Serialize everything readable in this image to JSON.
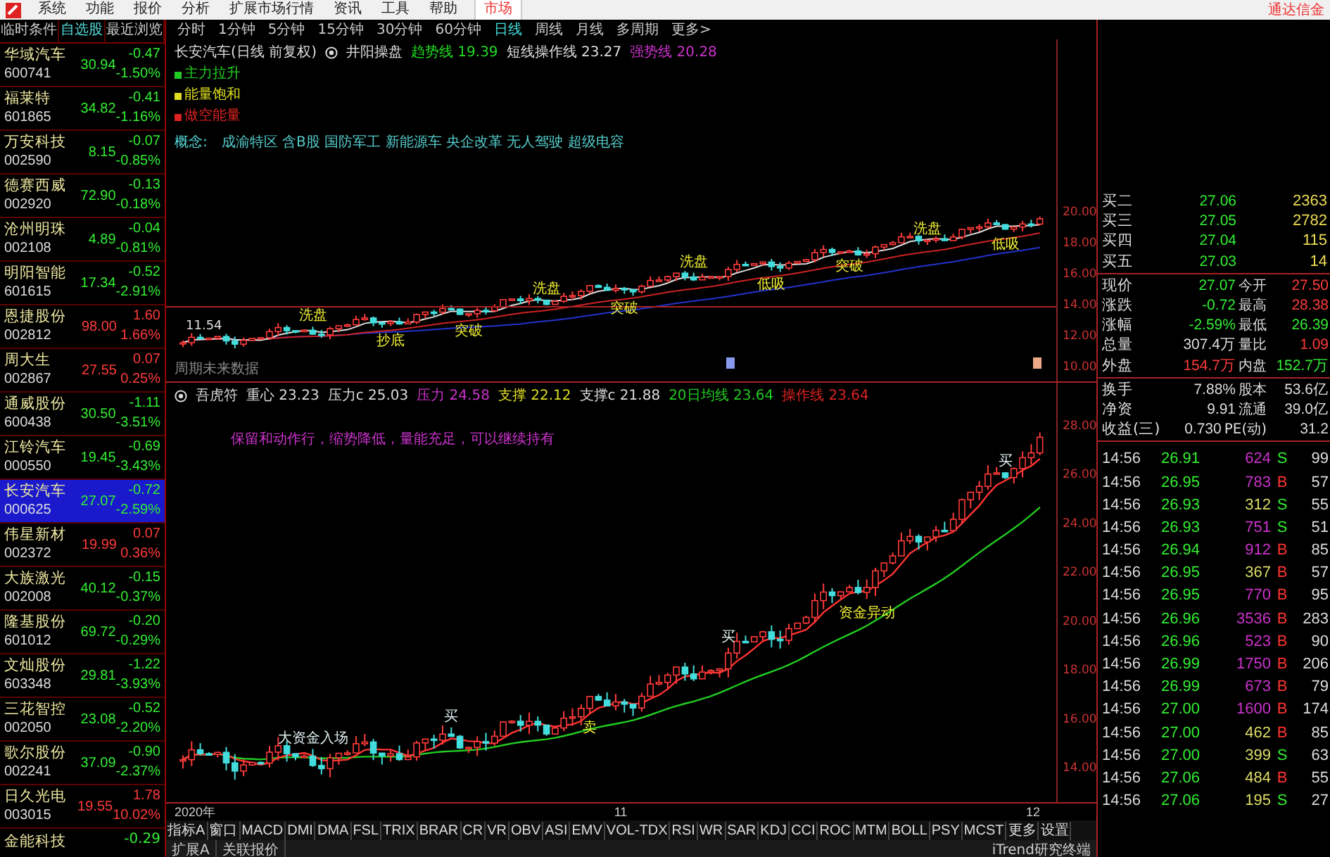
{
  "menu": {
    "items": [
      {
        "label": "系统",
        "selected": false
      },
      {
        "label": "功能",
        "selected": false
      },
      {
        "label": "报价",
        "selected": false
      },
      {
        "label": "分析",
        "selected": false
      },
      {
        "label": "扩展市场行情",
        "selected": false
      },
      {
        "label": "资讯",
        "selected": false
      },
      {
        "label": "工具",
        "selected": false
      },
      {
        "label": "帮助",
        "selected": false
      },
      {
        "label": "市场",
        "selected": true
      }
    ],
    "right_text": "通达信金"
  },
  "watchlist": {
    "tabs": [
      {
        "label": "临时条件",
        "selected": false
      },
      {
        "label": "自选股",
        "selected": true
      },
      {
        "label": "最近浏览",
        "selected": false
      }
    ],
    "rows": [
      {
        "name": "华域汽车",
        "code": "600741",
        "price": "30.94",
        "change": "-0.47",
        "pct": "-1.50%",
        "up": false,
        "selected": false
      },
      {
        "name": "福莱特",
        "code": "601865",
        "price": "34.82",
        "change": "-0.41",
        "pct": "-1.16%",
        "up": false,
        "selected": false
      },
      {
        "name": "万安科技",
        "code": "002590",
        "price": "8.15",
        "change": "-0.07",
        "pct": "-0.85%",
        "up": false,
        "selected": false
      },
      {
        "name": "德赛西威",
        "code": "002920",
        "price": "72.90",
        "change": "-0.13",
        "pct": "-0.18%",
        "up": false,
        "selected": false
      },
      {
        "name": "沧州明珠",
        "code": "002108",
        "price": "4.89",
        "change": "-0.04",
        "pct": "-0.81%",
        "up": false,
        "selected": false
      },
      {
        "name": "明阳智能",
        "code": "601615",
        "price": "17.34",
        "change": "-0.52",
        "pct": "-2.91%",
        "up": false,
        "selected": false
      },
      {
        "name": "恩捷股份",
        "code": "002812",
        "price": "98.00",
        "change": "1.60",
        "pct": "1.66%",
        "up": true,
        "selected": false
      },
      {
        "name": "周大生",
        "code": "002867",
        "price": "27.55",
        "change": "0.07",
        "pct": "0.25%",
        "up": true,
        "selected": false
      },
      {
        "name": "通威股份",
        "code": "600438",
        "price": "30.50",
        "change": "-1.11",
        "pct": "-3.51%",
        "up": false,
        "selected": false
      },
      {
        "name": "江铃汽车",
        "code": "000550",
        "price": "19.45",
        "change": "-0.69",
        "pct": "-3.43%",
        "up": false,
        "selected": false
      },
      {
        "name": "长安汽车",
        "code": "000625",
        "price": "27.07",
        "change": "-0.72",
        "pct": "-2.59%",
        "up": false,
        "selected": true
      },
      {
        "name": "伟星新材",
        "code": "002372",
        "price": "19.99",
        "change": "0.07",
        "pct": "0.36%",
        "up": true,
        "selected": false
      },
      {
        "name": "大族激光",
        "code": "002008",
        "price": "40.12",
        "change": "-0.15",
        "pct": "-0.37%",
        "up": false,
        "selected": false
      },
      {
        "name": "隆基股份",
        "code": "601012",
        "price": "69.72",
        "change": "-0.20",
        "pct": "-0.29%",
        "up": false,
        "selected": false
      },
      {
        "name": "文灿股份",
        "code": "603348",
        "price": "29.81",
        "change": "-1.22",
        "pct": "-3.93%",
        "up": false,
        "selected": false
      },
      {
        "name": "三花智控",
        "code": "002050",
        "price": "23.08",
        "change": "-0.52",
        "pct": "-2.20%",
        "up": false,
        "selected": false
      },
      {
        "name": "歌尔股份",
        "code": "002241",
        "price": "37.09",
        "change": "-0.90",
        "pct": "-2.37%",
        "up": false,
        "selected": false
      },
      {
        "name": "日久光电",
        "code": "003015",
        "price": "19.55",
        "change": "1.78",
        "pct": "10.02%",
        "up": true,
        "selected": false
      }
    ],
    "partial_row": {
      "name": "金能科技",
      "change": "-0.29",
      "up": false
    }
  },
  "periods": [
    {
      "label": "分时",
      "selected": false
    },
    {
      "label": "1分钟",
      "selected": false
    },
    {
      "label": "5分钟",
      "selected": false
    },
    {
      "label": "15分钟",
      "selected": false
    },
    {
      "label": "30分钟",
      "selected": false
    },
    {
      "label": "60分钟",
      "selected": false
    },
    {
      "label": "日线",
      "selected": true
    },
    {
      "label": "周线",
      "selected": false
    },
    {
      "label": "月线",
      "selected": false
    },
    {
      "label": "多周期",
      "selected": false
    },
    {
      "label": "更多>",
      "selected": false
    }
  ],
  "upper_chart": {
    "title": "长安汽车(日线 前复权)",
    "indicator": "井阳操盘",
    "readings": [
      {
        "label": "趋势线",
        "value": "19.39",
        "color": "#22dd22"
      },
      {
        "label": "短线操作线",
        "value": "23.27",
        "color": "#dddddd"
      },
      {
        "label": "强势线",
        "value": "20.28",
        "color": "#cc33cc"
      }
    ],
    "legend": [
      {
        "text": "主力拉升",
        "color": "#22cc22"
      },
      {
        "text": "能量饱和",
        "color": "#dddd22"
      },
      {
        "text": "做空能量",
        "color": "#dd2222"
      }
    ],
    "concept_label": "概念:",
    "concepts": "成渝特区 含B股 国防军工 新能源车 央企改革 无人驾驶 超级电容",
    "start_price": "11.54",
    "footnote": "周期未来数据",
    "y_axis": [
      "20.00",
      "18.00",
      "16.00",
      "14.00",
      "12.00",
      "10.00"
    ],
    "signals": [
      {
        "text": "洗盘",
        "kind": "top"
      },
      {
        "text": "抄底",
        "kind": "bottom"
      },
      {
        "text": "突破",
        "kind": "bottom"
      },
      {
        "text": "洗盘",
        "kind": "top"
      },
      {
        "text": "突破",
        "kind": "bottom"
      },
      {
        "text": "洗盘",
        "kind": "top"
      },
      {
        "text": "低吸",
        "kind": "bottom"
      },
      {
        "text": "突破",
        "kind": "bottom"
      },
      {
        "text": "洗盘",
        "kind": "top"
      },
      {
        "text": "低吸",
        "kind": "bottom"
      }
    ]
  },
  "lower_chart": {
    "indicator": "吾虎符",
    "readings": [
      {
        "label": "重心",
        "value": "23.23",
        "color": "#dddddd"
      },
      {
        "label": "压力c",
        "value": "25.03",
        "color": "#dddddd"
      },
      {
        "label": "压力",
        "value": "24.58",
        "color": "#cc33cc"
      },
      {
        "label": "支撑",
        "value": "22.12",
        "color": "#dddd22"
      },
      {
        "label": "支撑c",
        "value": "21.88",
        "color": "#dddddd"
      },
      {
        "label": "20日均线",
        "value": "23.64",
        "color": "#22cc22"
      },
      {
        "label": "操作线",
        "value": "23.64",
        "color": "#dd2222"
      }
    ],
    "note": "保留和动作行，缩势降低，量能充足，可以继续持有",
    "y_axis": [
      "28.00",
      "26.00",
      "24.00",
      "22.00",
      "20.00",
      "18.00",
      "16.00",
      "14.00"
    ],
    "signals": [
      {
        "text": "大资金入场",
        "kind": "top"
      },
      {
        "text": "买",
        "kind": "top"
      },
      {
        "text": "卖",
        "kind": "bottom"
      },
      {
        "text": "买",
        "kind": "top"
      },
      {
        "text": "资金异动",
        "kind": "bottom"
      },
      {
        "text": "买",
        "kind": "top"
      }
    ],
    "x_axis": [
      "2020年",
      "11",
      "12"
    ]
  },
  "indicator_tabs": [
    "指标A",
    "窗口",
    "MACD",
    "DMI",
    "DMA",
    "FSL",
    "TRIX",
    "BRAR",
    "CR",
    "VR",
    "OBV",
    "ASI",
    "EMV",
    "VOL-TDX",
    "RSI",
    "WR",
    "SAR",
    "KDJ",
    "CCI",
    "ROC",
    "MTM",
    "BOLL",
    "PSY",
    "MCST",
    "更多",
    "设置"
  ],
  "status_bar": {
    "tabs": [
      "扩展A",
      "关联报价"
    ],
    "right": "iTrend研究终端"
  },
  "quote": {
    "bids": [
      {
        "label": "买二",
        "price": "27.06",
        "volume": "2363"
      },
      {
        "label": "买三",
        "price": "27.05",
        "volume": "2782"
      },
      {
        "label": "买四",
        "price": "27.04",
        "volume": "115"
      },
      {
        "label": "买五",
        "price": "27.03",
        "volume": "14"
      }
    ],
    "stats": [
      {
        "label": "现价",
        "value": "27.07",
        "up": false,
        "label2": "今开",
        "value2": "27.50",
        "up2": true
      },
      {
        "label": "涨跌",
        "value": "-0.72",
        "up": false,
        "label2": "最高",
        "value2": "28.38",
        "up2": true
      },
      {
        "label": "涨幅",
        "value": "-2.59%",
        "up": false,
        "label2": "最低",
        "value2": "26.39",
        "up2": false
      },
      {
        "label": "总量",
        "value": "307.4万",
        "label2": "量比",
        "value2": "1.09",
        "up2": true
      },
      {
        "label": "外盘",
        "value": "154.7万",
        "up": true,
        "label2": "内盘",
        "value2": "152.7万",
        "up2": false
      }
    ],
    "info": [
      {
        "label": "换手",
        "value": "7.88%",
        "label2": "股本",
        "value2": "53.6亿"
      },
      {
        "label": "净资",
        "value": "9.91",
        "label2": "流通",
        "value2": "39.0亿"
      },
      {
        "label": "收益(三)",
        "value": "0.730",
        "label2": "PE(动)",
        "value2": "31.2"
      }
    ],
    "ticks": [
      {
        "time": "14:56",
        "price": "26.91",
        "volume": "624",
        "side": "S",
        "buy": false,
        "color": "#cc33cc",
        "count": "99"
      },
      {
        "time": "14:56",
        "price": "26.95",
        "volume": "783",
        "side": "B",
        "buy": true,
        "color": "#cc33cc",
        "count": "57"
      },
      {
        "time": "14:56",
        "price": "26.93",
        "volume": "312",
        "side": "S",
        "buy": false,
        "color": "#dddd66",
        "count": "55"
      },
      {
        "time": "14:56",
        "price": "26.93",
        "volume": "751",
        "side": "S",
        "buy": false,
        "color": "#cc33cc",
        "count": "51"
      },
      {
        "time": "14:56",
        "price": "26.94",
        "volume": "912",
        "side": "B",
        "buy": true,
        "color": "#cc33cc",
        "count": "85"
      },
      {
        "time": "14:56",
        "price": "26.95",
        "volume": "367",
        "side": "B",
        "buy": true,
        "color": "#dddd66",
        "count": "57"
      },
      {
        "time": "14:56",
        "price": "26.95",
        "volume": "770",
        "side": "B",
        "buy": true,
        "color": "#cc33cc",
        "count": "95"
      },
      {
        "time": "14:56",
        "price": "26.96",
        "volume": "3536",
        "side": "B",
        "buy": true,
        "color": "#cc33cc",
        "count": "283"
      },
      {
        "time": "14:56",
        "price": "26.96",
        "volume": "523",
        "side": "B",
        "buy": true,
        "color": "#cc33cc",
        "count": "90"
      },
      {
        "time": "14:56",
        "price": "26.99",
        "volume": "1750",
        "side": "B",
        "buy": true,
        "color": "#cc33cc",
        "count": "206"
      },
      {
        "time": "14:56",
        "price": "26.99",
        "volume": "673",
        "side": "B",
        "buy": true,
        "color": "#cc33cc",
        "count": "79"
      },
      {
        "time": "14:56",
        "price": "27.00",
        "volume": "1600",
        "side": "B",
        "buy": true,
        "color": "#cc33cc",
        "count": "174"
      },
      {
        "time": "14:56",
        "price": "27.00",
        "volume": "462",
        "side": "B",
        "buy": true,
        "color": "#dddd66",
        "count": "85"
      },
      {
        "time": "14:56",
        "price": "27.00",
        "volume": "399",
        "side": "S",
        "buy": false,
        "color": "#dddd66",
        "count": "63"
      },
      {
        "time": "14:56",
        "price": "27.06",
        "volume": "484",
        "side": "B",
        "buy": true,
        "color": "#dddd66",
        "count": "55"
      },
      {
        "time": "14:56",
        "price": "27.06",
        "volume": "195",
        "side": "S",
        "buy": false,
        "color": "#dddd66",
        "count": "27"
      }
    ]
  }
}
